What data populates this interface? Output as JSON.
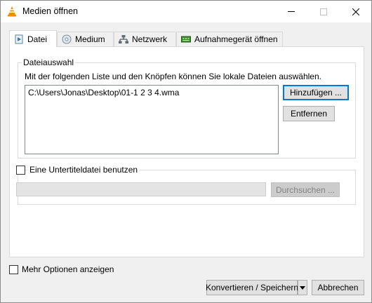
{
  "window": {
    "title": "Medien öffnen",
    "icon": "vlc-cone-icon"
  },
  "tabs": [
    {
      "label": "Datei",
      "icon": "file-icon",
      "active": true
    },
    {
      "label": "Medium",
      "icon": "disc-icon",
      "active": false
    },
    {
      "label": "Netzwerk",
      "icon": "network-icon",
      "active": false
    },
    {
      "label": "Aufnahmegerät öffnen",
      "icon": "capture-device-icon",
      "active": false
    }
  ],
  "file_section": {
    "legend": "Dateiauswahl",
    "info": "Mit der folgenden Liste und den Knöpfen können Sie lokale Dateien auswählen.",
    "files": [
      "C:\\Users\\Jonas\\Desktop\\01-1 2 3 4.wma"
    ],
    "add_button": "Hinzufügen ...",
    "remove_button": "Entfernen"
  },
  "subtitle_section": {
    "checkbox_label": "Eine Untertiteldatei benutzen",
    "checked": false,
    "path_value": "",
    "browse_button": "Durchsuchen ..."
  },
  "more_options": {
    "label": "Mehr Optionen anzeigen",
    "checked": false
  },
  "footer": {
    "convert_button": "Konvertieren / Speichern",
    "cancel_button": "Abbrechen"
  },
  "colors": {
    "accent": "#0078d7",
    "vlc_orange": "#f48b00"
  }
}
